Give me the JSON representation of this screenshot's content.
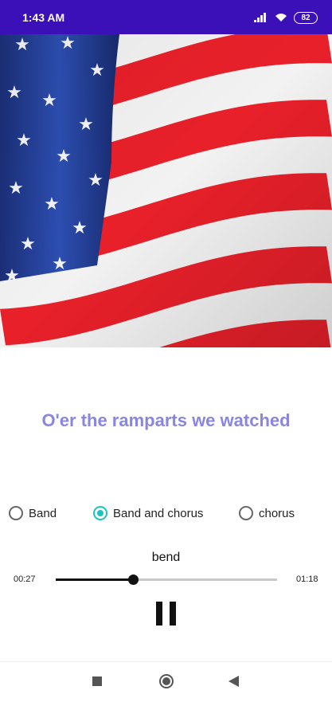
{
  "status_bar": {
    "time": "1:43 AM",
    "battery": "82",
    "background_color": "#3b10b8",
    "icons": [
      "signal-icon",
      "wifi-icon",
      "battery-icon"
    ]
  },
  "hero_image": {
    "icon": "american-flag-image"
  },
  "lyric": {
    "text": "O'er the ramparts we watched",
    "color": "#8a86e0"
  },
  "mode_options": [
    {
      "label": "Band",
      "selected": false
    },
    {
      "label": "Band and chorus",
      "selected": true
    },
    {
      "label": "chorus",
      "selected": false
    }
  ],
  "player": {
    "track_title": "bend",
    "elapsed": "00:27",
    "duration": "01:18",
    "progress_fraction": 0.35,
    "pause_icon": "pause-icon"
  },
  "nav_bar": {
    "icons": [
      "recents-icon",
      "home-icon",
      "back-icon"
    ]
  },
  "colors": {
    "accent": "#1cc4c0",
    "flag_red": "#e8202a",
    "flag_blue": "#1f3a8a"
  }
}
